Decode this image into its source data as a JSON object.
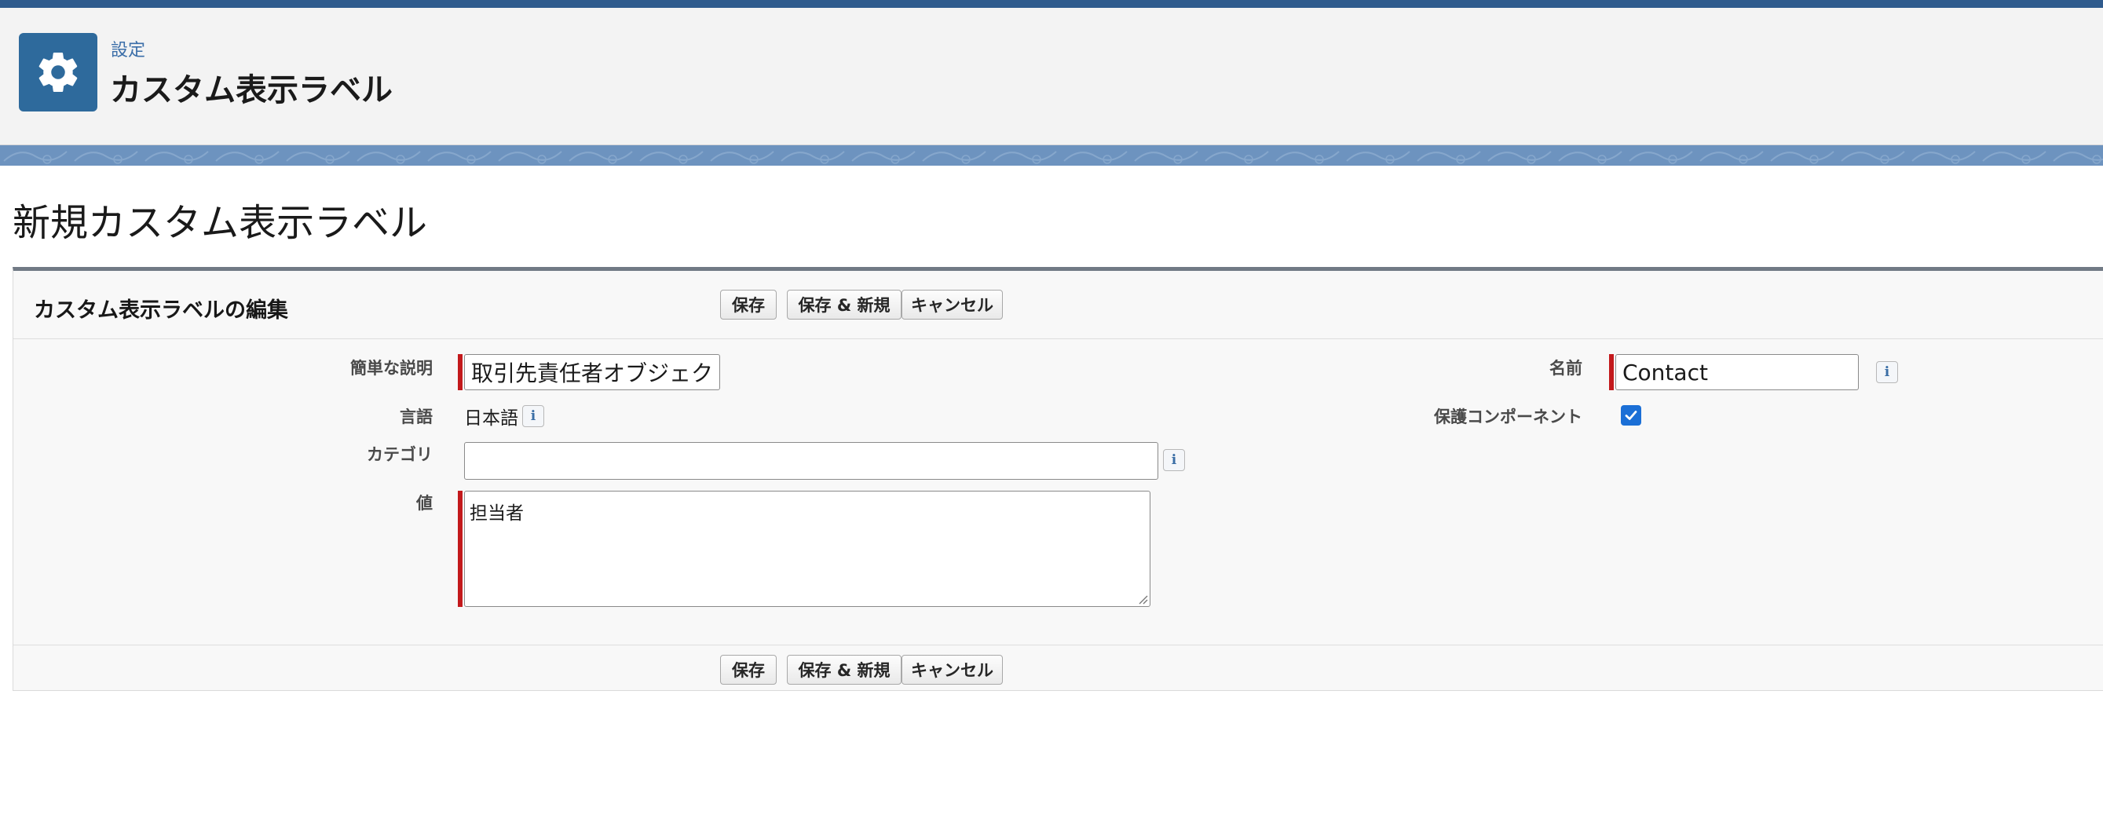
{
  "header": {
    "breadcrumb": "設定",
    "title": "カスタム表示ラベル",
    "icon": "gear-icon"
  },
  "main": {
    "title": "新規カスタム表示ラベル"
  },
  "panel": {
    "title": "カスタム表示ラベルの編集",
    "buttons": {
      "save": "保存",
      "save_new": "保存 & 新規",
      "cancel": "キャンセル"
    }
  },
  "form": {
    "short_description": {
      "label": "簡単な説明",
      "value": "取引先責任者オブジェクト"
    },
    "name": {
      "label": "名前",
      "value": "Contact"
    },
    "language": {
      "label": "言語",
      "value": "日本語"
    },
    "protected_component": {
      "label": "保護コンポーネント",
      "checked": true
    },
    "category": {
      "label": "カテゴリ",
      "value": ""
    },
    "value": {
      "label": "値",
      "value": "担当者"
    },
    "info_glyph": "i"
  },
  "colors": {
    "accent": "#2e6a9c",
    "required": "#c3191c",
    "checkbox": "#1b6fd6"
  }
}
